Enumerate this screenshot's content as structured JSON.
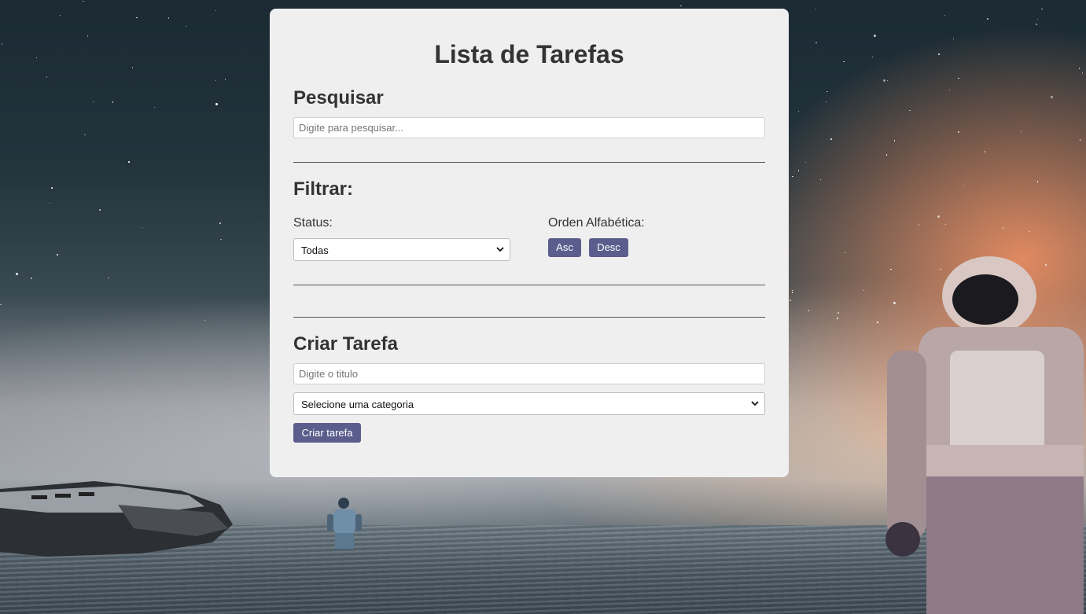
{
  "page": {
    "title": "Lista de Tarefas"
  },
  "search": {
    "heading": "Pesquisar",
    "placeholder": "Digite para pesquisar..."
  },
  "filter": {
    "heading": "Filtrar:",
    "status_label": "Status:",
    "status_selected": "Todas",
    "order_label": "Orden Alfabética:",
    "asc_label": "Asc",
    "desc_label": "Desc"
  },
  "create": {
    "heading": "Criar Tarefa",
    "title_placeholder": "Digite o titulo",
    "category_selected": "Selecione uma categoria",
    "submit_label": "Criar tarefa"
  },
  "colors": {
    "panel_bg": "#efefef",
    "button_bg": "#5b5e8c",
    "text": "#333333"
  },
  "icons": {
    "select_chevron": "chevron-down-icon"
  }
}
